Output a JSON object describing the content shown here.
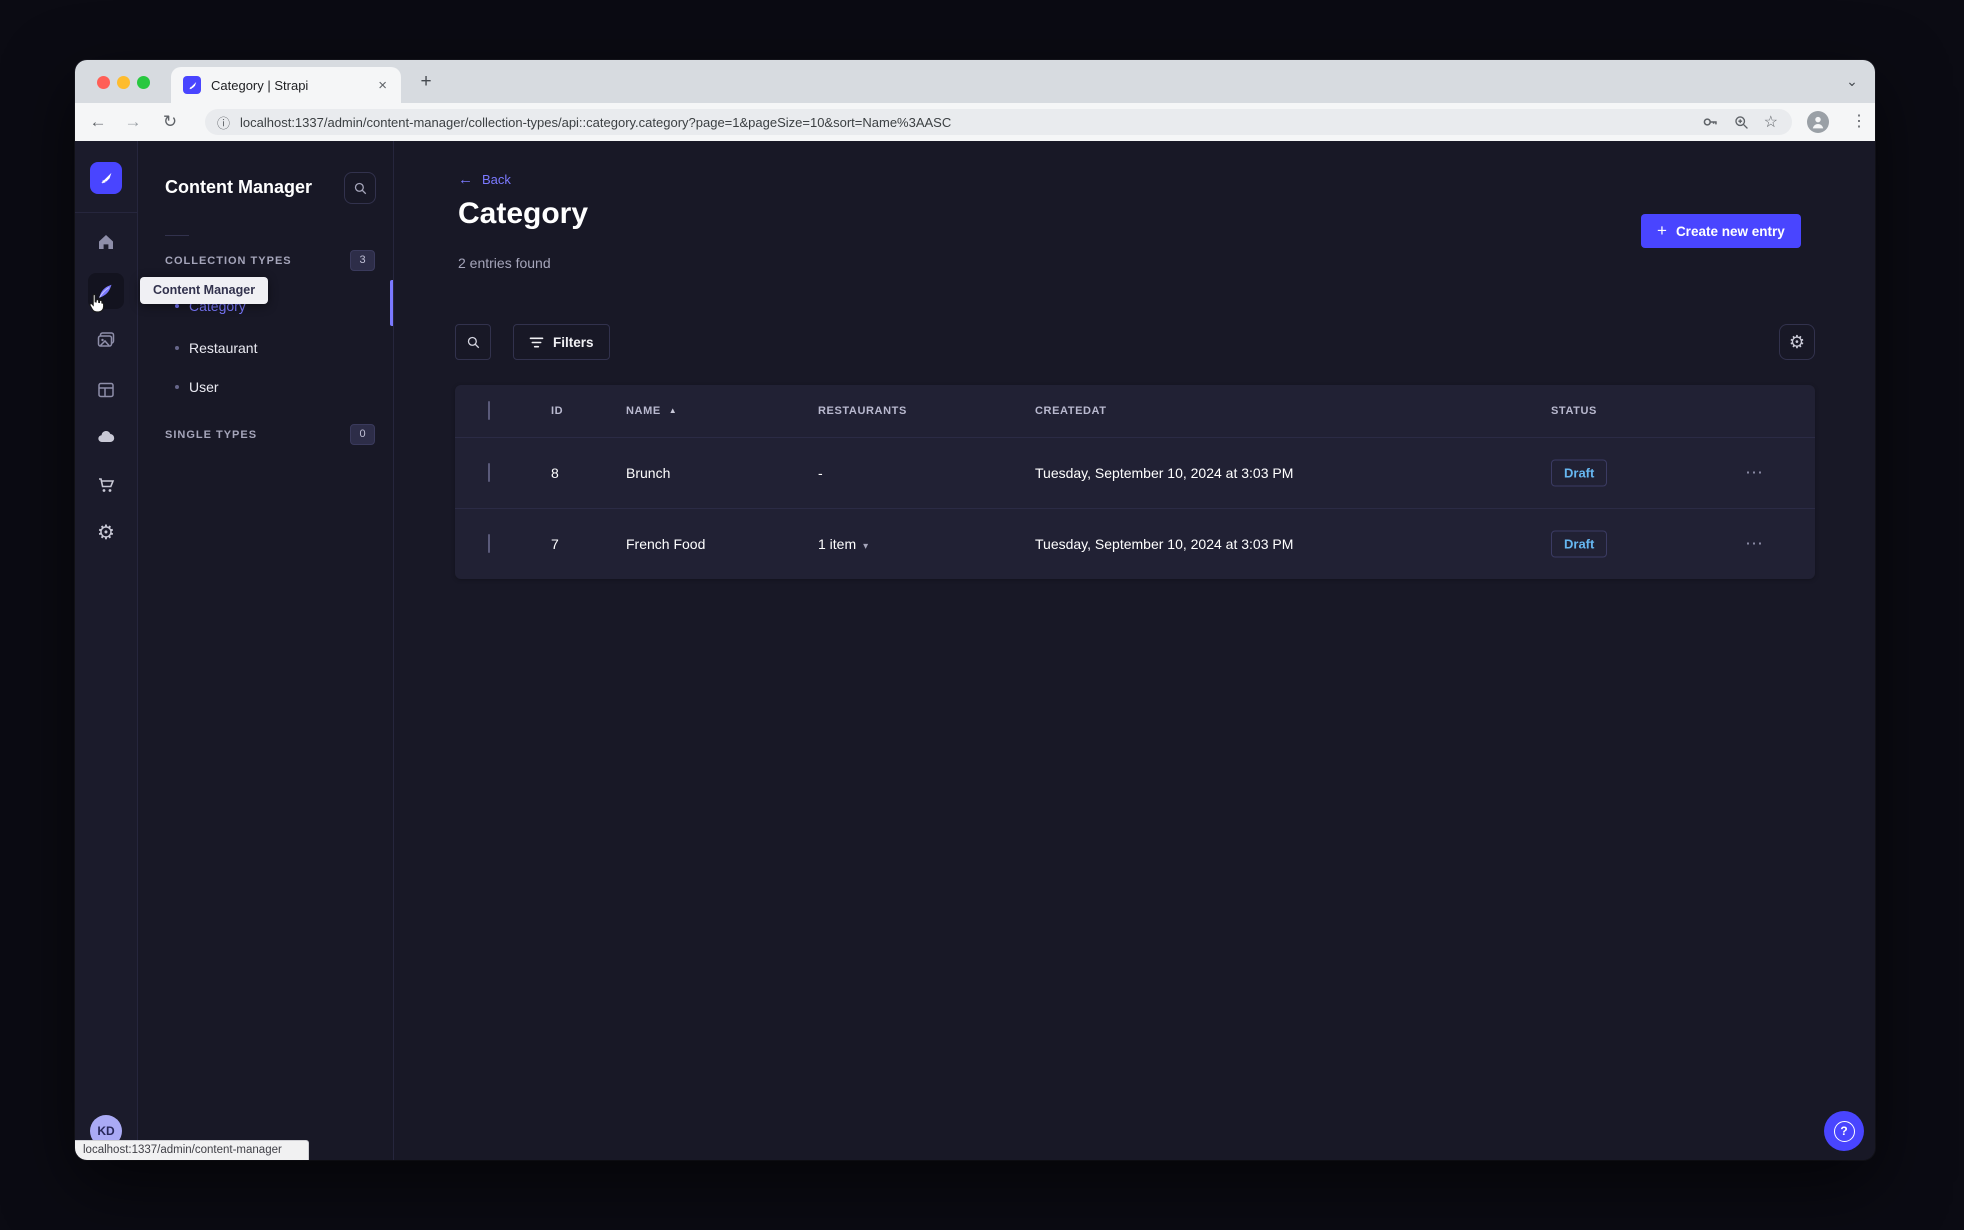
{
  "browser": {
    "tab_title": "Category | Strapi",
    "url": "localhost:1337/admin/content-manager/collection-types/api::category.category?page=1&pageSize=10&sort=Name%3AASC",
    "status_bar": "localhost:1337/admin/content-manager"
  },
  "sidebar": {
    "tooltip": "Content Manager",
    "avatar_initials": "KD"
  },
  "subnav": {
    "title": "Content Manager",
    "collection_types": {
      "label": "COLLECTION TYPES",
      "count": "3"
    },
    "single_types": {
      "label": "SINGLE TYPES",
      "count": "0"
    },
    "items": [
      {
        "label": "Category"
      },
      {
        "label": "Restaurant"
      },
      {
        "label": "User"
      }
    ]
  },
  "content": {
    "back_label": "Back",
    "title": "Category",
    "subtitle": "2 entries found",
    "create_button": "Create new entry",
    "filters_button": "Filters",
    "table": {
      "headers": {
        "id": "ID",
        "name": "NAME",
        "restaurants": "RESTAURANTS",
        "createdat": "CREATEDAT",
        "status": "STATUS"
      },
      "rows": [
        {
          "id": "8",
          "name": "Brunch",
          "restaurants": "-",
          "createdat": "Tuesday, September 10, 2024 at 3:03 PM",
          "status": "Draft"
        },
        {
          "id": "7",
          "name": "French Food",
          "restaurants": "1 item",
          "createdat": "Tuesday, September 10, 2024 at 3:03 PM",
          "status": "Draft"
        }
      ]
    }
  },
  "icons": {
    "back_arrow": "←",
    "forward_arrow": "→",
    "reload": "↻",
    "info": "ⓘ",
    "star": "☆",
    "menu_dots": "⋮",
    "row_dots": "⋯",
    "plus": "+",
    "close": "×",
    "chevron_down": "⌄",
    "caret_down": "▾",
    "sort_asc": "▲",
    "question": "?",
    "gear": "⚙"
  },
  "colors": {
    "primary": "#4945ff",
    "link": "#7b79ff",
    "draft_text": "#66b7f1",
    "app_bg": "#181826",
    "panel_bg": "#212134"
  }
}
